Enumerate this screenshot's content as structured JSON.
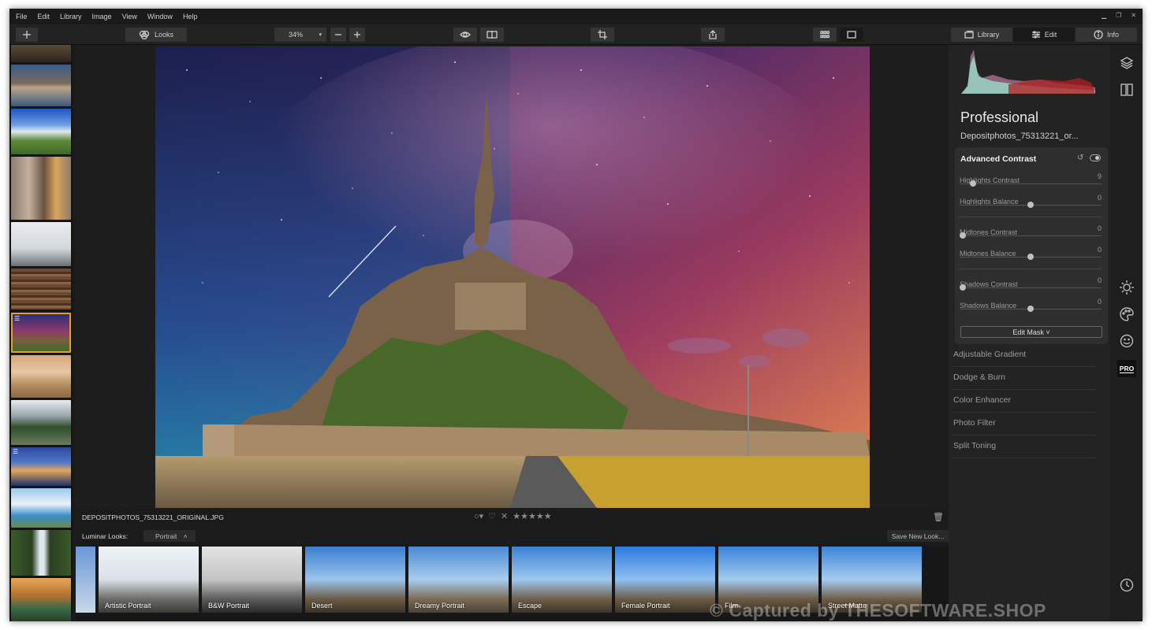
{
  "menu": [
    "File",
    "Edit",
    "Library",
    "Image",
    "View",
    "Window",
    "Help"
  ],
  "toolbar": {
    "looks_label": "Looks",
    "zoom": "34%",
    "tabs": [
      "Library",
      "Edit",
      "Info"
    ]
  },
  "photo": {
    "filename": "DEPOSITPHOTOS_75313221_ORIGINAL.JPG"
  },
  "luminar_looks": {
    "label": "Luminar Looks:",
    "category": "Portrait",
    "save_label": "Save New Look...",
    "items": [
      "Artistic Portrait",
      "B&W Portrait",
      "Desert",
      "Dreamy Portrait",
      "Escape",
      "Female Portrait",
      "Film",
      "Street Matte"
    ]
  },
  "panel": {
    "workspace": "Professional",
    "file_short": "Depositphotos_75313221_or...",
    "filter_title": "Advanced Contrast",
    "sliders": [
      {
        "name": "Highlights Contrast",
        "value": "9"
      },
      {
        "name": "Highlights Balance",
        "value": "0"
      },
      {
        "name": "Midtones Contrast",
        "value": "0"
      },
      {
        "name": "Midtones Balance",
        "value": "0"
      },
      {
        "name": "Shadows Contrast",
        "value": "0"
      },
      {
        "name": "Shadows Balance",
        "value": "0"
      }
    ],
    "edit_mask": "Edit Mask",
    "filters": [
      "Adjustable Gradient",
      "Dodge & Burn",
      "Color Enhancer",
      "Photo Filter",
      "Split Toning"
    ]
  },
  "side_icons": [
    "layers-icon",
    "compare-icon",
    "sun-icon",
    "palette-icon",
    "smile-icon",
    "pro-icon",
    "history-icon"
  ],
  "pro_badge": "PRO",
  "watermark": "© Captured by THESOFTWARE.SHOP"
}
